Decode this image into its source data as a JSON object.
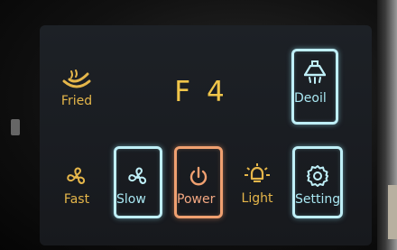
{
  "display": {
    "code": "F 4"
  },
  "buttons": {
    "fried": "Fried",
    "deoil": "Deoil",
    "fast": "Fast",
    "slow": "Slow",
    "power": "Power",
    "light": "Light",
    "setting": "Setting"
  },
  "colors": {
    "gold": "#e5b64a",
    "blue_glow": "#bfeff7",
    "orange_glow": "#f0a070"
  },
  "icons": {
    "fried": "fried-pan-icon",
    "deoil": "range-hood-icon",
    "fast": "fan-icon",
    "slow": "fan-icon",
    "power": "power-icon",
    "light": "light-bulb-icon",
    "setting": "gear-icon"
  }
}
